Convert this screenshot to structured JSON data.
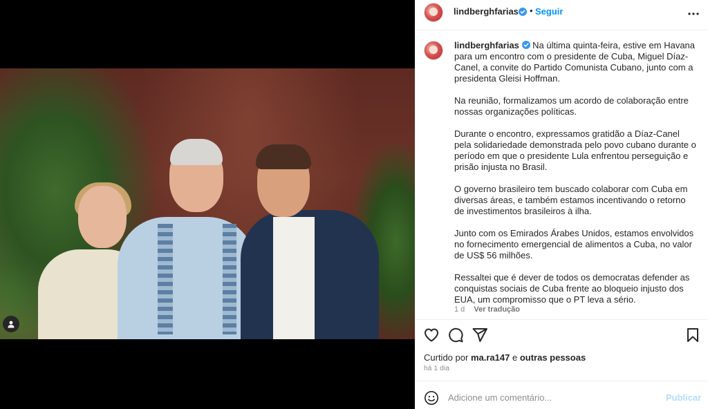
{
  "header": {
    "username": "lindberghfarias",
    "separator": "•",
    "follow_label": "Seguir",
    "more_icon": "more-horizontal-icon"
  },
  "caption": {
    "username": "lindberghfarias",
    "paragraphs": [
      "Na última quinta-feira, estive em Havana para um encontro com o presidente de Cuba, Miguel Díaz-Canel, a convite do Partido Comunista Cubano, junto com a presidenta Gleisi Hoffman.",
      "Na reunião, formalizamos um acordo de colaboração entre nossas organizações políticas.",
      "Durante o encontro, expressamos gratidão a Díaz-Canel pela solidariedade demonstrada pelo povo cubano durante o período em que o presidente Lula enfrentou perseguição e prisão injusta no Brasil.",
      "O governo brasileiro tem buscado colaborar com Cuba em diversas áreas, e também estamos incentivando o retorno de investimentos brasileiros à ilha.",
      "Junto com os Emirados Árabes Unidos, estamos envolvidos no fornecimento emergencial de alimentos a Cuba, no valor de US$ 56 milhões.",
      "Ressaltei que é dever de todos os democratas defender as conquistas sociais de Cuba frente ao bloqueio injusto dos EUA, um compromisso que o PT leva a sério."
    ],
    "age": "1 d",
    "translate_label": "Ver tradução"
  },
  "likes": {
    "prefix": "Curtido por",
    "user": "ma.ra147",
    "middle": "e",
    "others": "outras pessoas"
  },
  "timestamp": "há 1 dia",
  "comment": {
    "placeholder": "Adicione um comentário...",
    "publish_label": "Publicar"
  },
  "colors": {
    "accent": "#0095f6",
    "publish_disabled": "#b2dffc",
    "verified": "#3897f0"
  }
}
